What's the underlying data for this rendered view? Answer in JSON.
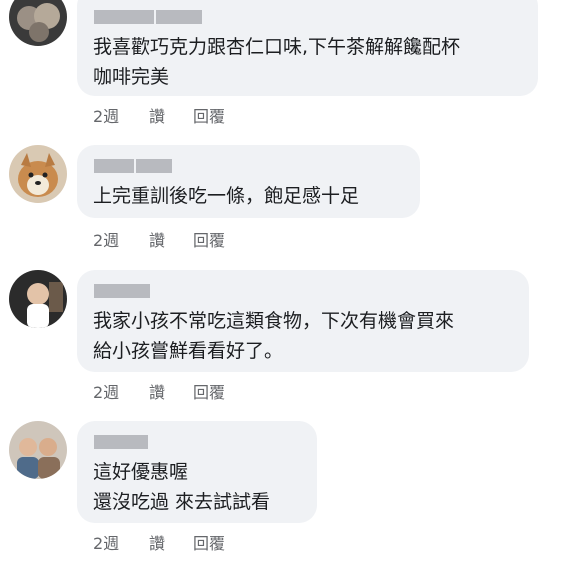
{
  "comments": [
    {
      "text_lines": [
        "我喜歡巧克力跟杏仁口味,下午茶解解饞配杯",
        "咖啡完美"
      ],
      "time": "2週",
      "like": "讚",
      "reply": "回覆"
    },
    {
      "text_lines": [
        "上完重訓後吃一條，飽足感十足"
      ],
      "time": "2週",
      "like": "讚",
      "reply": "回覆"
    },
    {
      "text_lines": [
        "我家小孩不常吃這類食物，下次有機會買來",
        "給小孩嘗鮮看看好了。"
      ],
      "time": "2週",
      "like": "讚",
      "reply": "回覆"
    },
    {
      "text_lines": [
        "這好優惠喔",
        "還沒吃過 來去試試看"
      ],
      "time": "2週",
      "like": "讚",
      "reply": "回覆"
    }
  ]
}
